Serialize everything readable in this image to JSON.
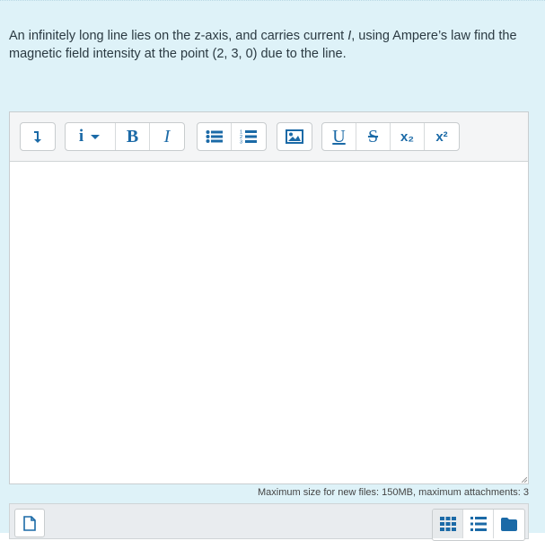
{
  "question": {
    "text_before": "An infinitely long line lies on the z-axis, and carries current ",
    "current_symbol": "I",
    "text_after": ", using Ampere’s law find the magnetic field intensity at the point (2, 3, 0) due to the line."
  },
  "toolbar": {
    "bold_label": "B",
    "italic_label": "I",
    "underline_label": "U",
    "strike_label": "S",
    "subscript_label": "x₂",
    "superscript_label": "x²",
    "info_label": "i"
  },
  "editor": {
    "content": ""
  },
  "files": {
    "limits": "Maximum size for new files: 150MB, maximum attachments: 3"
  },
  "colors": {
    "panel_bg": "#def2f8",
    "icon_blue": "#1b6aa7"
  }
}
